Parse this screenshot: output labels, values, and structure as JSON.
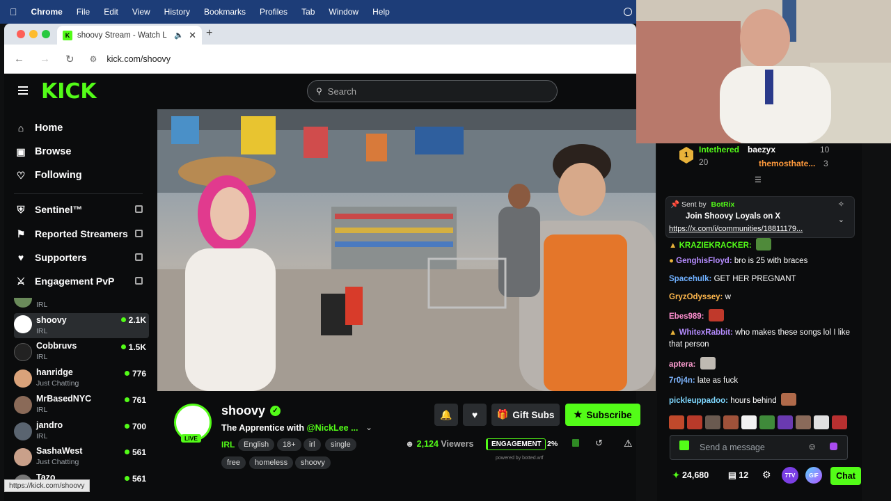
{
  "menubar": {
    "apple": "",
    "items": [
      "Chrome",
      "File",
      "Edit",
      "View",
      "History",
      "Bookmarks",
      "Profiles",
      "Tab",
      "Window",
      "Help"
    ]
  },
  "browser": {
    "tab_title": "shoovy Stream - Watch L",
    "tab_favicon": "K",
    "new_tab": "+",
    "url": "kick.com/shoovy",
    "status_url": "https://kick.com/shoovy"
  },
  "kick": {
    "logo": "KICK",
    "search_placeholder": "Search",
    "nav": {
      "home": "Home",
      "browse": "Browse",
      "following": "Following"
    },
    "extensions": [
      "Sentinel™",
      "Reported Streamers",
      "Supporters",
      "Engagement PvP"
    ],
    "partial_channel_category": "IRL",
    "channels": [
      {
        "name": "shoovy",
        "category": "IRL",
        "viewers": "2.1K"
      },
      {
        "name": "Cobbruvs",
        "category": "IRL",
        "viewers": "1.5K"
      },
      {
        "name": "hanridge",
        "category": "Just Chatting",
        "viewers": "776"
      },
      {
        "name": "MrBasedNYC",
        "category": "IRL",
        "viewers": "761"
      },
      {
        "name": "jandro",
        "category": "IRL",
        "viewers": "700"
      },
      {
        "name": "SashaWest",
        "category": "Just Chatting",
        "viewers": "561"
      },
      {
        "name": "Tazo",
        "category": "",
        "viewers": "561"
      }
    ]
  },
  "stream": {
    "streamer": "shoovy",
    "live_badge": "LIVE",
    "title_prefix": "The Apprentice with ",
    "title_mention": "@NickLee ...",
    "category": "IRL",
    "tags": [
      "English",
      "18+",
      "irl",
      "single",
      "free",
      "homeless",
      "shoovy"
    ],
    "gift_subs": "Gift Subs",
    "subscribe": "Subscribe",
    "viewers_count": "2,124",
    "viewers_label": "Viewers",
    "engagement_label": "ENGAGEMENT",
    "engagement_pct": "2%",
    "powered_by": "powered by botted.wtf"
  },
  "chat": {
    "leaderboard": [
      {
        "rank": "1",
        "name": "Intethered",
        "count": "20"
      },
      {
        "rank": "",
        "name": "baezyx",
        "count": "10"
      },
      {
        "rank": "",
        "name": "themosthate...",
        "count": "3"
      }
    ],
    "pinned": {
      "sent_by_label": "Sent by",
      "sender": "BotRix",
      "text": "Join Shoovy Loyals on X",
      "link": "https://x.com/i/communities/18811179..."
    },
    "messages": [
      {
        "user": "KRAZIEKRACKER:",
        "text": "",
        "color": "#53fc18"
      },
      {
        "user": "GenghisFloyd:",
        "text": "bro is 25 with braces",
        "color": "#b58cff"
      },
      {
        "user": "Spacehulk:",
        "text": "GET HER PREGNANT",
        "color": "#6fb0ff"
      },
      {
        "user": "GryzOdyssey:",
        "text": "w",
        "color": "#ffb84d"
      },
      {
        "user": "Ebes989:",
        "text": "",
        "color": "#ff8fd0"
      },
      {
        "user": "WhitexRabbit:",
        "text": "who makes these songs lol I like that person",
        "color": "#b58cff"
      },
      {
        "user": "aptera:",
        "text": "",
        "color": "#ff9ed2"
      },
      {
        "user": "7r0j4n:",
        "text": "late as fuck",
        "color": "#7fb6ff"
      },
      {
        "user": "pickleuppadoo:",
        "text": "hours behind",
        "color": "#7fd8ff"
      }
    ],
    "input_placeholder": "Send a message",
    "points": "24,680",
    "gifts_count": "12",
    "btn_7tv": "7TV",
    "btn_gif": "GIF",
    "chat_button": "Chat"
  },
  "colors": {
    "kick_green": "#53fc18",
    "background": "#0b0c0d",
    "menubar": "#1d3d78"
  }
}
